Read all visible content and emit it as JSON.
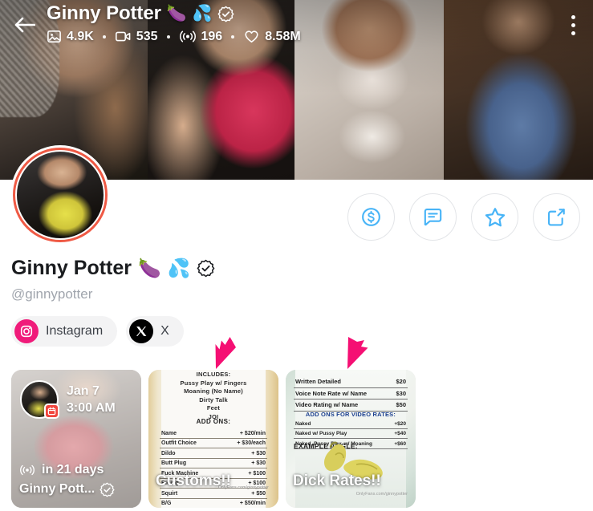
{
  "header": {
    "back_icon": "back-arrow-icon",
    "menu_icon": "kebab-menu-icon",
    "title": "Ginny Potter",
    "title_emojis": [
      "🍆",
      "💦"
    ],
    "verified_icon": "verified-badge-icon",
    "stats": [
      {
        "icon": "photo-icon",
        "value": "4.9K"
      },
      {
        "icon": "video-icon",
        "value": "535"
      },
      {
        "icon": "live-stream-icon",
        "value": "196"
      },
      {
        "icon": "heart-icon",
        "value": "8.58M"
      }
    ]
  },
  "avatar": {
    "name": "profile-avatar",
    "ring_color": "#ef5a45"
  },
  "actions": [
    {
      "name": "tip-button",
      "icon": "dollar-circle-icon"
    },
    {
      "name": "message-button",
      "icon": "chat-bubble-icon"
    },
    {
      "name": "favorite-button",
      "icon": "star-icon"
    },
    {
      "name": "share-button",
      "icon": "share-icon"
    }
  ],
  "profile": {
    "display_name": "Ginny Potter",
    "emojis": [
      "🍆",
      "💦"
    ],
    "verified_icon": "verified-badge-icon",
    "handle": "@ginnypotter",
    "socials": [
      {
        "label": "Instagram",
        "icon": "instagram-icon",
        "color": "#f01b7a"
      },
      {
        "label": "X",
        "icon": "x-twitter-icon",
        "color": "#000000"
      }
    ]
  },
  "cursors": [
    {
      "name": "pink-cursor-arrow-1",
      "color": "#f50f73"
    },
    {
      "name": "pink-cursor-arrow-2",
      "color": "#f50f73"
    }
  ],
  "cards": [
    {
      "type": "scheduled-stream",
      "date": "Jan 7",
      "time": "3:00 AM",
      "countdown": "in 21 days",
      "author": "Ginny Pott...",
      "live_icon": "live-stream-icon",
      "schedule_badge_icon": "calendar-badge-icon",
      "verified_icon": "verified-badge-icon"
    },
    {
      "type": "customs-menu",
      "title": "Customs!!",
      "top_lines": [
        "INCLUDES:",
        "Pussy Play w/ Fingers",
        "Moaning (No Name)",
        "Dirty Talk",
        "Feet",
        "JOI"
      ],
      "addons_heading": "ADD ONS:",
      "addons": [
        {
          "label": "Name",
          "price": "+ $20/min"
        },
        {
          "label": "Outfit Choice",
          "price": "+ $30/each"
        },
        {
          "label": "Dildo",
          "price": "+ $30"
        },
        {
          "label": "Butt Plug",
          "price": "+ $30"
        },
        {
          "label": "Fuck Machine",
          "price": "+ $100"
        },
        {
          "label": "Riding",
          "price": "+ $100"
        },
        {
          "label": "Squirt",
          "price": "+ $50"
        },
        {
          "label": "B/G",
          "price": "+ $50/min"
        }
      ],
      "watermark": "OnlyFans.com/ginnypotter"
    },
    {
      "type": "dick-rates-menu",
      "title": "Dick Rates!!",
      "rates": [
        {
          "label": "Written Detailed",
          "price": "$20"
        },
        {
          "label": "Voice Note Rate w/ Name",
          "price": "$30"
        },
        {
          "label": "Video Rating w/ Name",
          "price": "$50"
        }
      ],
      "addons_heading": "ADD ONS FOR VIDEO RATES:",
      "addons": [
        {
          "label": "Naked",
          "price": "+$20"
        },
        {
          "label": "Naked w/ Pussy Play",
          "price": "+$40"
        },
        {
          "label": "Naked, Pussy Play, w/ Moaning",
          "price": "+$60"
        }
      ],
      "example_label": "EXAMPLE ANGLE:",
      "watermark": "OnlyFans.com/ginnypotter"
    }
  ]
}
